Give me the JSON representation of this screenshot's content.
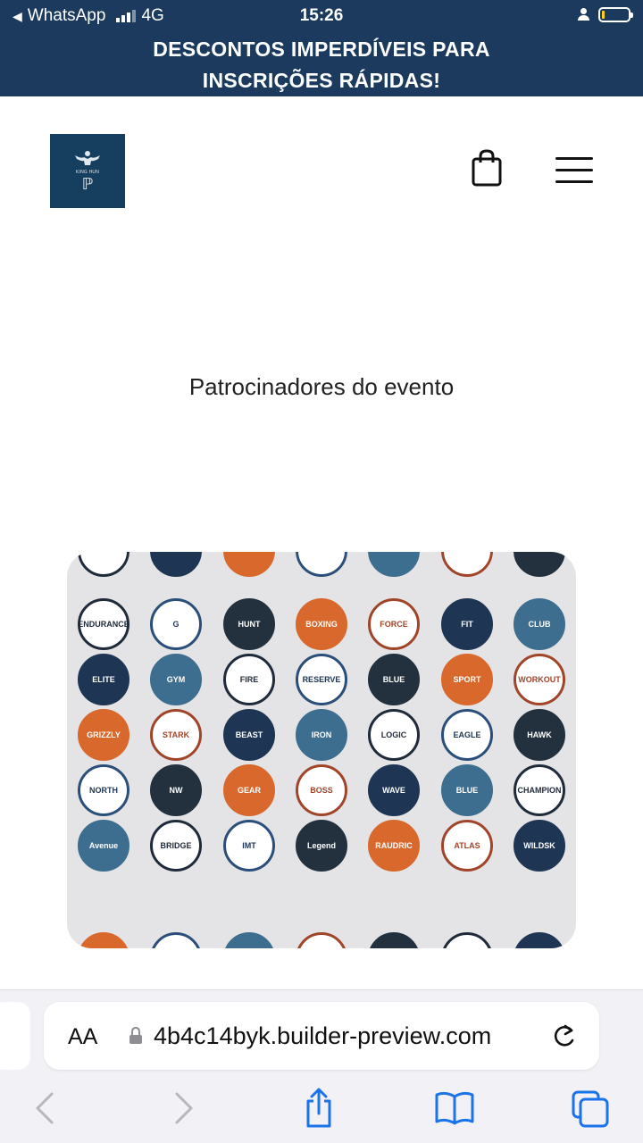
{
  "status_bar": {
    "back_app": "WhatsApp",
    "network": "4G",
    "time": "15:26",
    "battery_level": 0.1
  },
  "banner": {
    "promo_line1": "DESCONTOS IMPERDÍVEIS PARA",
    "promo_line2": "INSCRIÇÕES RÁPIDAS!"
  },
  "header": {
    "logo_text": "KING HUN",
    "logo_icon": "strongman-icon",
    "cart_icon": "shopping-bag-icon",
    "menu_icon": "hamburger-menu-icon"
  },
  "main": {
    "section_title": "Patrocinadores do evento"
  },
  "sponsor_logos": [
    "ENDURANCE",
    "G",
    "HUNT",
    "BOXING",
    "FORCE",
    "FIT",
    "CLUB",
    "ELITE",
    "GYM",
    "FIRE",
    "RESERVE",
    "BLUE",
    "SPORT",
    "WORKOUT",
    "GRIZZLY",
    "STARK",
    "BEAST",
    "IRON",
    "LOGIC",
    "EAGLE",
    "HAWK",
    "NORTH",
    "NW",
    "GEAR",
    "BOSS",
    "WAVE",
    "BLUE",
    "CHAMPION",
    "Avenue",
    "BRIDGE",
    "IMT",
    "Legend",
    "RAUDRIC",
    "ATLAS",
    "WILDSK"
  ],
  "colors": {
    "banner_bg": "#1b3a5e",
    "logo_bg": "#163e5f",
    "ios_accent": "#1a73e8"
  },
  "browser": {
    "aa_label": "AA",
    "url": "4b4c14byk.builder-preview.com",
    "nav_icons": [
      "back-icon",
      "forward-icon",
      "share-icon",
      "bookmarks-icon",
      "tabs-icon"
    ]
  }
}
